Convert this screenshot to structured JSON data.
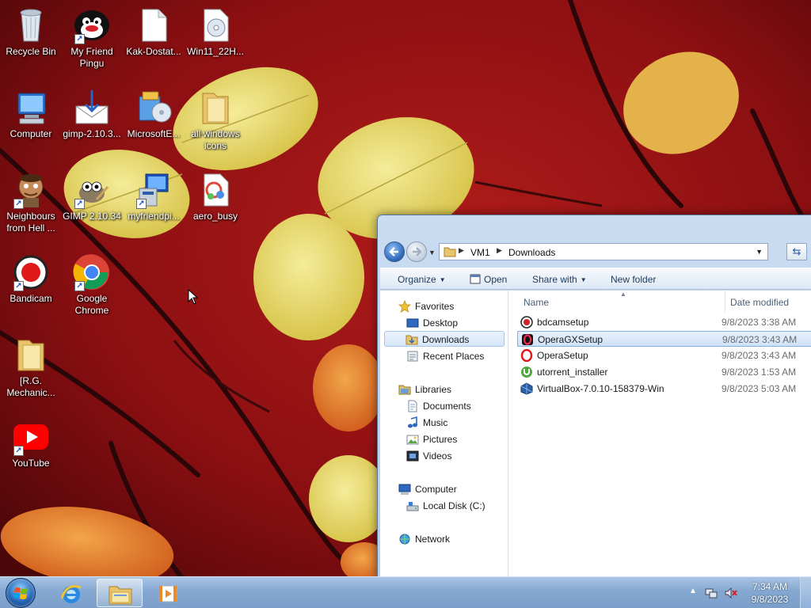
{
  "desktop": {
    "icons": [
      {
        "label": "Recycle Bin",
        "icon": "recycle-bin-icon"
      },
      {
        "label": "My Friend Pingu",
        "icon": "pingu-icon"
      },
      {
        "label": "Kak-Dostat...",
        "icon": "blank-file-icon"
      },
      {
        "label": "Win11_22H...",
        "icon": "disc-image-icon"
      },
      {
        "label": "Computer",
        "icon": "computer-icon"
      },
      {
        "label": "gimp-2.10.3...",
        "icon": "installer-download-icon"
      },
      {
        "label": "MicrosoftE...",
        "icon": "setup-package-icon"
      },
      {
        "label": "all windows icons",
        "icon": "folder-icon"
      },
      {
        "label": "Neighbours from Hell ...",
        "icon": "neighbour-game-icon"
      },
      {
        "label": "GIMP 2.10.34",
        "icon": "gimp-icon"
      },
      {
        "label": "myfriendpi...",
        "icon": "setup-computer-icon"
      },
      {
        "label": "aero_busy",
        "icon": "aero-busy-cursor-icon"
      },
      {
        "label": "Bandicam",
        "icon": "bandicam-icon"
      },
      {
        "label": "Google Chrome",
        "icon": "chrome-icon"
      },
      {
        "label": "[R.G. Mechanic...",
        "icon": "folder-icon"
      },
      {
        "label": "YouTube",
        "icon": "youtube-icon"
      }
    ]
  },
  "explorer": {
    "breadcrumb": [
      "VM1",
      "Downloads"
    ],
    "toolbar": {
      "organize": "Organize",
      "open": "Open",
      "share_with": "Share with",
      "new_folder": "New folder"
    },
    "nav": {
      "favorites": "Favorites",
      "desktop": "Desktop",
      "downloads": "Downloads",
      "recent_places": "Recent Places",
      "libraries": "Libraries",
      "documents": "Documents",
      "music": "Music",
      "pictures": "Pictures",
      "videos": "Videos",
      "computer": "Computer",
      "local_disk": "Local Disk (C:)",
      "network": "Network"
    },
    "columns": {
      "name": "Name",
      "date_modified": "Date modified"
    },
    "files": [
      {
        "name": "bdcamsetup",
        "date": "9/8/2023 3:38 AM",
        "icon": "bandicam-setup-icon"
      },
      {
        "name": "OperaGXSetup",
        "date": "9/8/2023 3:43 AM",
        "icon": "opera-gx-icon",
        "selected": true
      },
      {
        "name": "OperaSetup",
        "date": "9/8/2023 3:43 AM",
        "icon": "opera-icon"
      },
      {
        "name": "utorrent_installer",
        "date": "9/8/2023 1:53 AM",
        "icon": "utorrent-icon"
      },
      {
        "name": "VirtualBox-7.0.10-158379-Win",
        "date": "9/8/2023 5:03 AM",
        "icon": "virtualbox-icon"
      }
    ]
  },
  "taskbar": {
    "clock_time": "7:34 AM",
    "clock_date": "9/8/2023",
    "pinned": [
      "internet-explorer-icon",
      "windows-explorer-icon",
      "media-player-icon"
    ]
  },
  "colors": {
    "wallpaper_red": "#8b0f12",
    "leaf_yellow": "#e8d66a",
    "selection_blue": "#cfe2f8",
    "taskbar_blue": "#85a8d2"
  }
}
